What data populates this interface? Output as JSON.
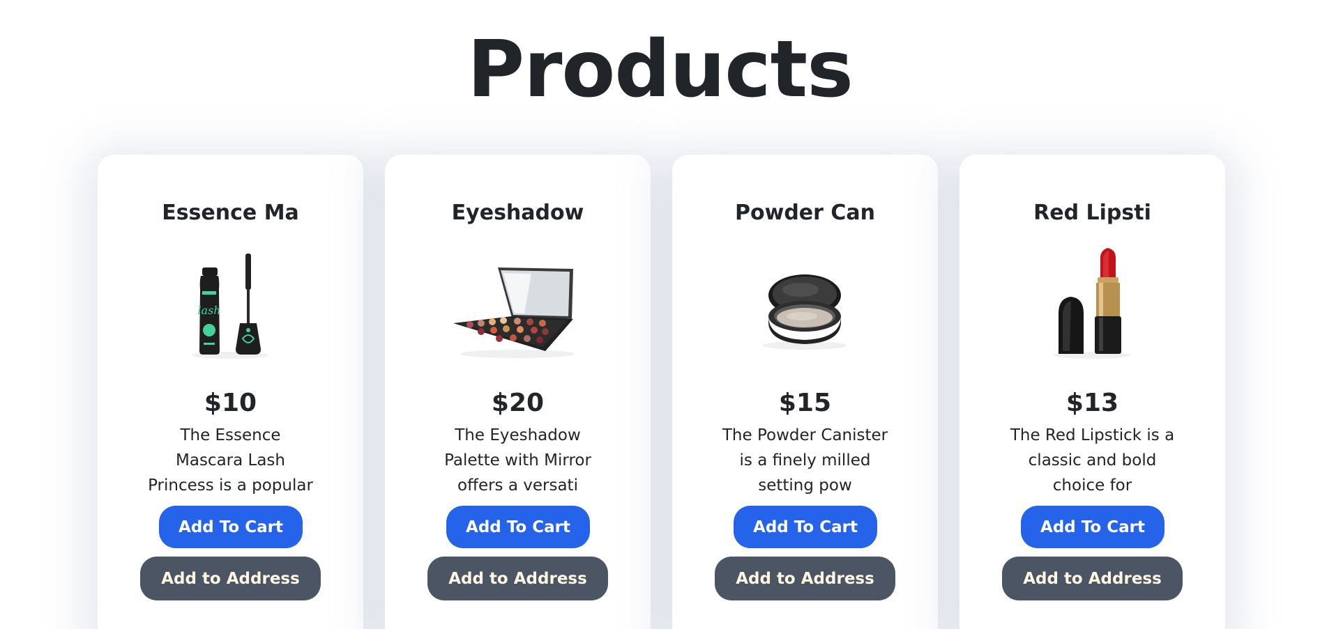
{
  "page": {
    "title": "Products"
  },
  "products": [
    {
      "name": "Essence Ma",
      "price": "$10",
      "description": "The Essence Mascara Lash Princess is a popular mas",
      "cart_label": "Add To Cart",
      "address_label": "Add to Address",
      "image_icon": "mascara-icon"
    },
    {
      "name": "Eyeshadow",
      "price": "$20",
      "description": "The Eyeshadow Palette with Mirror offers a versati",
      "cart_label": "Add To Cart",
      "address_label": "Add to Address",
      "image_icon": "eyeshadow-palette-icon"
    },
    {
      "name": "Powder Can",
      "price": "$15",
      "description": "The Powder Canister is a finely milled setting pow",
      "cart_label": "Add To Cart",
      "address_label": "Add to Address",
      "image_icon": "powder-canister-icon"
    },
    {
      "name": "Red Lipsti",
      "price": "$13",
      "description": "The Red Lipstick is a classic and bold choice for",
      "cart_label": "Add To Cart",
      "address_label": "Add to Address",
      "image_icon": "lipstick-icon"
    }
  ],
  "colors": {
    "primary_button": "#2563eb",
    "secondary_button": "#4b5563",
    "text": "#212529"
  }
}
